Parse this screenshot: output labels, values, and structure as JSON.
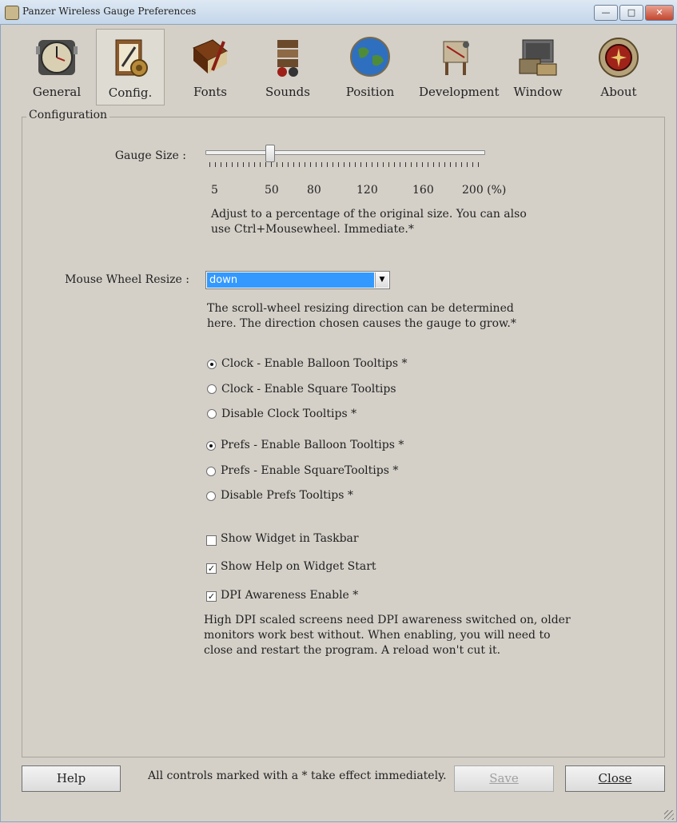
{
  "window": {
    "title": "Panzer Wireless Gauge Preferences",
    "minimize_glyph": "—",
    "maximize_glyph": "□",
    "close_glyph": "✕"
  },
  "toolbar": {
    "items": [
      {
        "label": "General",
        "icon": "gauge-clock-icon"
      },
      {
        "label": "Config.",
        "icon": "clipboard-gears-icon"
      },
      {
        "label": "Fonts",
        "icon": "book-pen-icon"
      },
      {
        "label": "Sounds",
        "icon": "gramophone-icon"
      },
      {
        "label": "Position",
        "icon": "globe-icon"
      },
      {
        "label": "Development",
        "icon": "drafting-table-icon"
      },
      {
        "label": "Window",
        "icon": "window-frames-icon"
      },
      {
        "label": "About",
        "icon": "brass-emblem-icon"
      }
    ],
    "selected": "Config."
  },
  "config": {
    "group_title": "Configuration",
    "gauge_size": {
      "label": "Gauge Size :",
      "value_percent": 50,
      "range": [
        5,
        200
      ],
      "tick_labels": [
        "5",
        "50",
        "80",
        "120",
        "160",
        "200 (%)"
      ],
      "help_line1": "Adjust to a percentage of the original size. You can also",
      "help_line2": "use Ctrl+Mousewheel. Immediate.*"
    },
    "mouse_wheel": {
      "label": "Mouse Wheel Resize :",
      "value": "down",
      "help_line1": "The scroll-wheel resizing direction can be determined",
      "help_line2": "here. The direction chosen causes the gauge to grow.*"
    },
    "clock_tooltips": [
      {
        "label": "Clock - Enable Balloon Tooltips *",
        "selected": true
      },
      {
        "label": "Clock - Enable Square Tooltips",
        "selected": false
      },
      {
        "label": "Disable Clock Tooltips *",
        "selected": false
      }
    ],
    "prefs_tooltips": [
      {
        "label": "Prefs - Enable Balloon Tooltips *",
        "selected": true
      },
      {
        "label": "Prefs - Enable SquareTooltips *",
        "selected": false
      },
      {
        "label": "Disable Prefs Tooltips *",
        "selected": false
      }
    ],
    "checkboxes": [
      {
        "label": "Show Widget in Taskbar",
        "checked": false,
        "mark": ""
      },
      {
        "label": "Show Help on Widget Start",
        "checked": true,
        "mark": "✓"
      },
      {
        "label": "DPI Awareness Enable *",
        "checked": true,
        "mark": "✓"
      }
    ],
    "dpi_help_line1": "High DPI scaled screens need DPI awareness switched on, older",
    "dpi_help_line2": "monitors work best without. When enabling, you will need to",
    "dpi_help_line3": "close and restart the program.  A reload won't cut it."
  },
  "footer": {
    "help_label": "Help",
    "note": "All controls marked with a * take effect immediately.",
    "save_label": "Save",
    "close_label": "Close"
  }
}
